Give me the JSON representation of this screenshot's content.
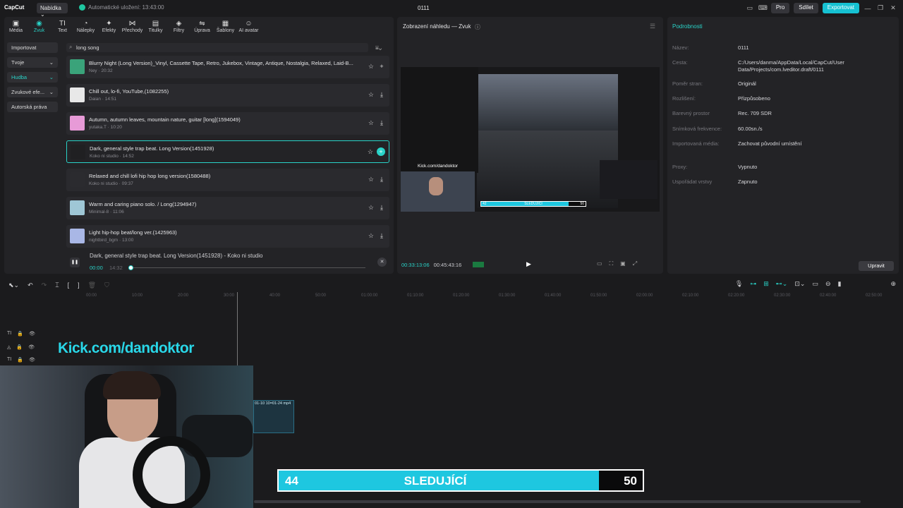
{
  "titlebar": {
    "logo": "CapCut",
    "menu_label": "Nabídka ⌄",
    "autosave": "Automatické uložení: 13:43:00",
    "project_name": "0111",
    "pro_label": "Pro",
    "share_label": "Sdílet",
    "export_label": "Exportovat"
  },
  "tools": [
    {
      "label": "Média",
      "icon": "media-icon",
      "glyph": "▣"
    },
    {
      "label": "Zvuk",
      "icon": "audio-icon",
      "glyph": "◉",
      "active": true
    },
    {
      "label": "Text",
      "icon": "text-icon",
      "glyph": "TI"
    },
    {
      "label": "Nálepky",
      "icon": "sticker-icon",
      "glyph": "◔"
    },
    {
      "label": "Efekty",
      "icon": "effects-icon",
      "glyph": "✦"
    },
    {
      "label": "Přechody",
      "icon": "transitions-icon",
      "glyph": "⋈"
    },
    {
      "label": "Titulky",
      "icon": "captions-icon",
      "glyph": "▤"
    },
    {
      "label": "Filtry",
      "icon": "filters-icon",
      "glyph": "◈"
    },
    {
      "label": "Úprava",
      "icon": "adjust-icon",
      "glyph": "⇋"
    },
    {
      "label": "Šablony",
      "icon": "templates-icon",
      "glyph": "▦"
    },
    {
      "label": "AI avatar",
      "icon": "ai-avatar-icon",
      "glyph": "☺"
    }
  ],
  "sidebar": [
    {
      "label": "Importovat",
      "arrow": ""
    },
    {
      "label": "Tvoje",
      "arrow": "⌄"
    },
    {
      "label": "Hudba",
      "arrow": "⌄",
      "active": true
    },
    {
      "label": "Zvukové efe...",
      "arrow": "⌄"
    },
    {
      "label": "Autorská práva",
      "arrow": ""
    }
  ],
  "search": {
    "value": "long song"
  },
  "tracks": [
    {
      "name": "Blurry Night (Long Version)_Vinyl, Cassette Tape, Retro, Jukebox, Vintage, Antique, Nostalgia, Relaxed, Laid-B...",
      "meta": "Ney · 20:32",
      "action": "+",
      "color": "#3aa37a"
    },
    {
      "name": "Chill out, lo-fi, YouTube,(1082255)",
      "meta": "Daian · 14:51",
      "action": "⤓",
      "color": "#e8e8e8"
    },
    {
      "name": "Autumn, autumn leaves, mountain nature, guitar [long](1594049)",
      "meta": "yutaka.T · 10:20",
      "action": "⤓",
      "color": "#e79ad7"
    },
    {
      "name": "Dark, general style trap beat. Long Version(1451928)",
      "meta": "Koko ni studio · 14:52",
      "action": "+",
      "color": "#202022",
      "selected": true
    },
    {
      "name": "Relaxed and chill lofi hip hop long version(1580488)",
      "meta": "Koko ni studio · 09:37",
      "action": "⤓",
      "color": "#2b2b2f"
    },
    {
      "name": "Warm and caring piano solo. / Long(1294947)",
      "meta": "Minimal-8 · 11:06",
      "action": "⤓",
      "color": "#9fc7d6"
    },
    {
      "name": "Light hip-hop beat/long ver.(1425963)",
      "meta": "nightbird_bgm · 13:00",
      "action": "⤓",
      "color": "#a9b7e6"
    }
  ],
  "player": {
    "title": "Dark, general style trap beat. Long Version(1451928) - Koko ni studio",
    "current": "00:00",
    "duration": "14:32",
    "progress": 0
  },
  "preview": {
    "header": "Zobrazení náhledu — Zvuk",
    "current_time": "00:33:13:06",
    "total_time": "00:45:43:16",
    "video_kick": "Kick.com/dandoktor",
    "bar_left": "42",
    "bar_mid": "SLEDUJÍCÍ",
    "bar_right": "50",
    "bar_fill": 0.84
  },
  "details": {
    "header": "Podrobnosti",
    "rows": [
      {
        "k": "Název:",
        "v": "0111"
      },
      {
        "k": "Cesta:",
        "v": "C:/Users/danma/AppData/Local/CapCut/User Data/Projects/com.lveditor.draft/0111"
      },
      {
        "k": "Poměr stran:",
        "v": "Originál"
      },
      {
        "k": "Rozlišení:",
        "v": "Přizpůsobeno"
      },
      {
        "k": "Barevný prostor",
        "v": "Rec. 709 SDR"
      },
      {
        "k": "Snímková frekvence:",
        "v": "60.00sn./s"
      },
      {
        "k": "Importovaná média:",
        "v": "Zachovat původní umístění"
      },
      {
        "k": "Proxy:",
        "v": "Vypnuto"
      },
      {
        "k": "Uspořádat vrstvy",
        "v": "Zapnuto"
      }
    ],
    "edit_label": "Upravit"
  },
  "timeline": {
    "ruler": [
      "00:00",
      "10:00",
      "20:00",
      "30:00",
      "40:00",
      "50:00",
      "01:00:00",
      "01:10:00",
      "01:20:00",
      "01:30:00",
      "01:40:00",
      "01:50:00",
      "02:00:00",
      "02:10:00",
      "02:20:00",
      "02:30:00",
      "02:40:00",
      "02:50:00"
    ],
    "clip_label": "01-10 10=01-24 mp4"
  },
  "overlay": {
    "kick": "Kick.com/dandoktor",
    "bar_left": "44",
    "bar_mid": "SLEDUJÍCÍ",
    "bar_right": "50",
    "bar_fill": 0.88
  },
  "colors": {
    "accent": "#29d3c8",
    "export": "#16c1d2",
    "follow_fill": "#1ec7e0"
  }
}
